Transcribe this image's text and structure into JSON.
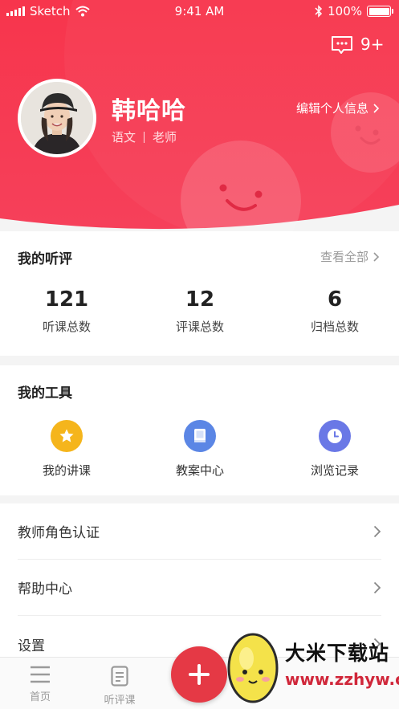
{
  "status_bar": {
    "carrier": "Sketch",
    "time": "9:41 AM",
    "battery": "100%"
  },
  "header": {
    "message_count": "9+",
    "bg_color": "#f5344f"
  },
  "profile": {
    "name": "韩哈哈",
    "subject": "语文",
    "role": "老师",
    "edit_label": "编辑个人信息"
  },
  "listening": {
    "title": "我的听评",
    "view_all": "查看全部",
    "stats": [
      {
        "value": "121",
        "label": "听课总数"
      },
      {
        "value": "12",
        "label": "评课总数"
      },
      {
        "value": "6",
        "label": "归档总数"
      }
    ]
  },
  "tools": {
    "title": "我的工具",
    "items": [
      {
        "label": "我的讲课",
        "icon": "star-icon",
        "color": "#f5b51c"
      },
      {
        "label": "教案中心",
        "icon": "book-icon",
        "color": "#5b86e5"
      },
      {
        "label": "浏览记录",
        "icon": "clock-icon",
        "color": "#6a78e6"
      }
    ]
  },
  "menu": [
    {
      "label": "教师角色认证"
    },
    {
      "label": "帮助中心"
    },
    {
      "label": "设置"
    }
  ],
  "tabbar": {
    "items": [
      {
        "label": "首页",
        "icon": "home-icon"
      },
      {
        "label": "听评课",
        "icon": "document-icon"
      }
    ],
    "fab_icon": "plus-icon"
  },
  "watermark": {
    "title": "大米下载站",
    "url": "www.zzhyw.com"
  }
}
